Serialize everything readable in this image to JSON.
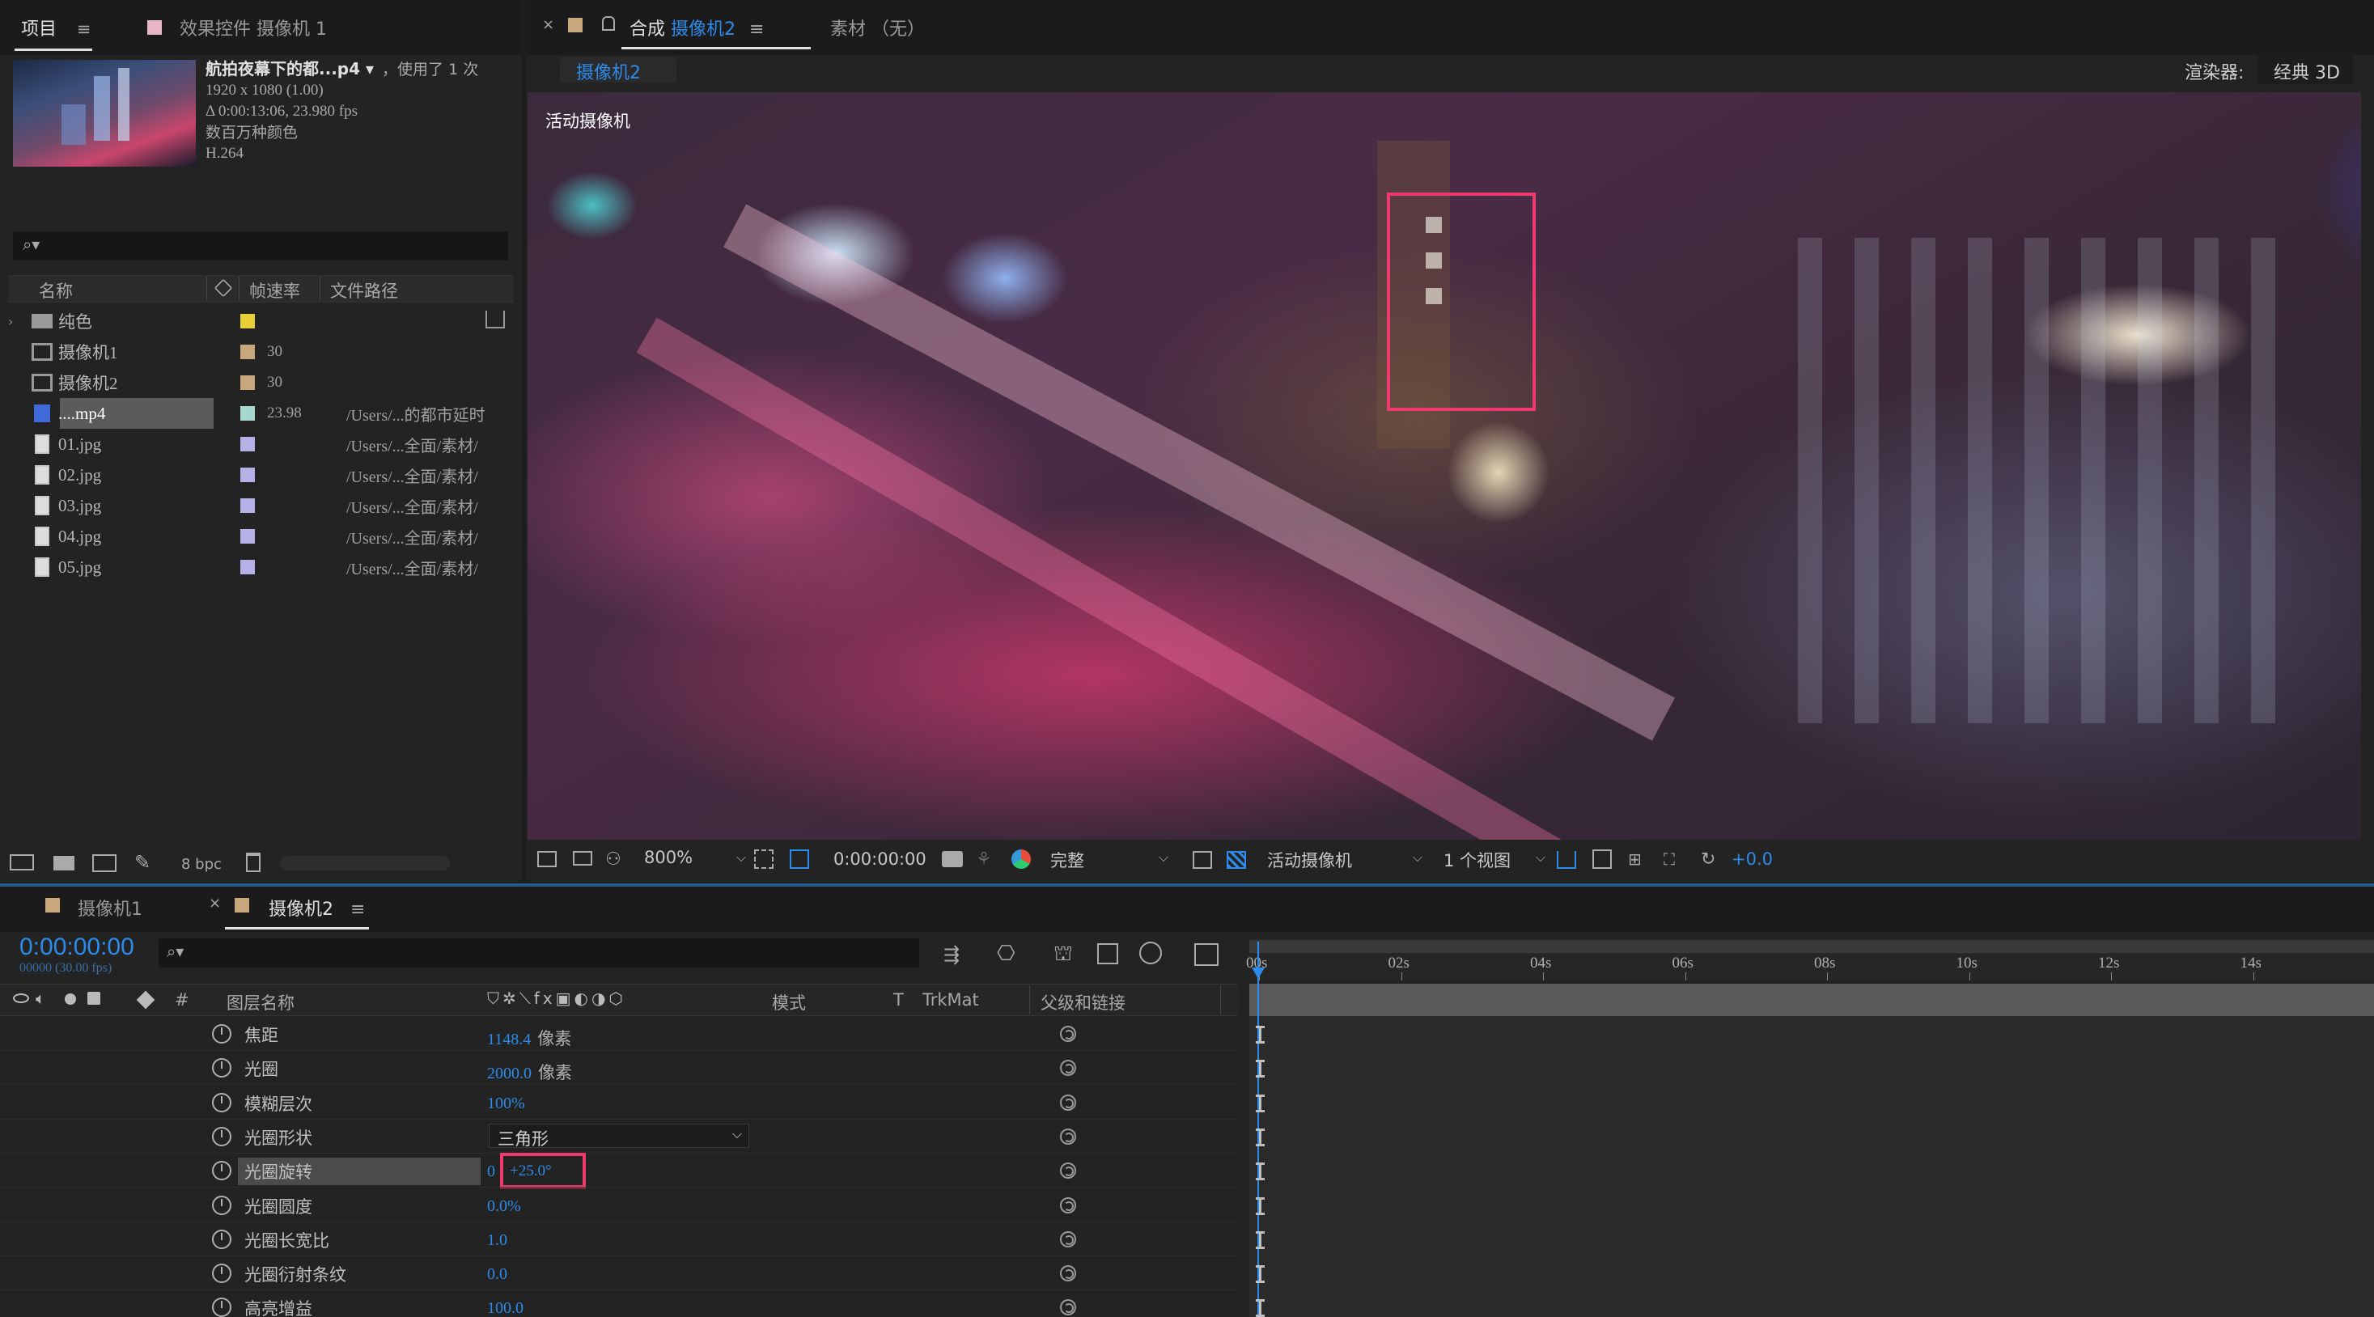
{
  "project_panel": {
    "tab_project": "项目",
    "tab_effects": "效果控件 摄像机 1",
    "footage_name": "航拍夜幕下的都...p4 ▾",
    "footage_used": "，使用了 1 次",
    "info_res": "1920 x 1080 (1.00)",
    "info_duration": "Δ 0:00:13:06, 23.980 fps",
    "info_colors": "数百万种颜色",
    "info_codec": "H.264",
    "col_name": "名称",
    "col_fps": "帧速率",
    "col_path": "文件路径",
    "items": [
      {
        "name": "纯色",
        "fps": "",
        "path": "",
        "label_color": "#e8cf3a",
        "type": "folder"
      },
      {
        "name": "摄像机1",
        "fps": "30",
        "path": "",
        "label_color": "#c7a77b",
        "type": "comp"
      },
      {
        "name": "摄像机2",
        "fps": "30",
        "path": "",
        "label_color": "#c7a77b",
        "type": "comp"
      },
      {
        "name": "....mp4",
        "fps": "23.98",
        "path": "/Users/...的都市延时",
        "label_color": "#a6d8cf",
        "type": "video"
      },
      {
        "name": "01.jpg",
        "fps": "",
        "path": "/Users/...全面/素材/",
        "label_color": "#b6b1e6",
        "type": "image"
      },
      {
        "name": "02.jpg",
        "fps": "",
        "path": "/Users/...全面/素材/",
        "label_color": "#b6b1e6",
        "type": "image"
      },
      {
        "name": "03.jpg",
        "fps": "",
        "path": "/Users/...全面/素材/",
        "label_color": "#b6b1e6",
        "type": "image"
      },
      {
        "name": "04.jpg",
        "fps": "",
        "path": "/Users/...全面/素材/",
        "label_color": "#b6b1e6",
        "type": "image"
      },
      {
        "name": "05.jpg",
        "fps": "",
        "path": "/Users/...全面/素材/",
        "label_color": "#b6b1e6",
        "type": "image"
      }
    ],
    "bpc": "8 bpc"
  },
  "comp_viewer": {
    "tab_comp_prefix": "合成",
    "tab_comp_name": "摄像机2",
    "tab_footage": "素材 （无）",
    "breadcrumb": "摄像机2",
    "renderer_label": "渲染器:",
    "renderer_value": "经典 3D",
    "view_label": "活动摄像机",
    "zoom": "800%",
    "timecode": "0:00:00:00",
    "resolution": "完整",
    "camera_select": "活动摄像机",
    "views_select": "1 个视图",
    "exposure": "+0.0"
  },
  "timeline": {
    "tab1": "摄像机1",
    "tab2": "摄像机2",
    "timecode": "0:00:00:00",
    "timecode_sub": "00000 (30.00 fps)",
    "col_layer_name": "图层名称",
    "col_mode": "模式",
    "col_t": "T",
    "col_trkmat": "TrkMat",
    "col_parent": "父级和链接",
    "col_hash": "#",
    "ruler_labels": [
      "00s",
      "02s",
      "04s",
      "06s",
      "08s",
      "10s",
      "12s",
      "14s"
    ],
    "properties": [
      {
        "name": "焦距",
        "value": "1148.4",
        "unit": "像素"
      },
      {
        "name": "光圈",
        "value": "2000.0",
        "unit": "像素"
      },
      {
        "name": "模糊层次",
        "value": "100%",
        "unit": ""
      },
      {
        "name": "光圈形状",
        "value": "三角形",
        "unit": "",
        "dropdown": true
      },
      {
        "name": "光圈旋转",
        "value": "0",
        "value2": "+25.0°",
        "unit": "",
        "selected": true
      },
      {
        "name": "光圈圆度",
        "value": "0.0%",
        "unit": ""
      },
      {
        "name": "光圈长宽比",
        "value": "1.0",
        "unit": ""
      },
      {
        "name": "光圈衍射条纹",
        "value": "0.0",
        "unit": ""
      },
      {
        "name": "高亮增益",
        "value": "100.0",
        "unit": ""
      }
    ]
  }
}
